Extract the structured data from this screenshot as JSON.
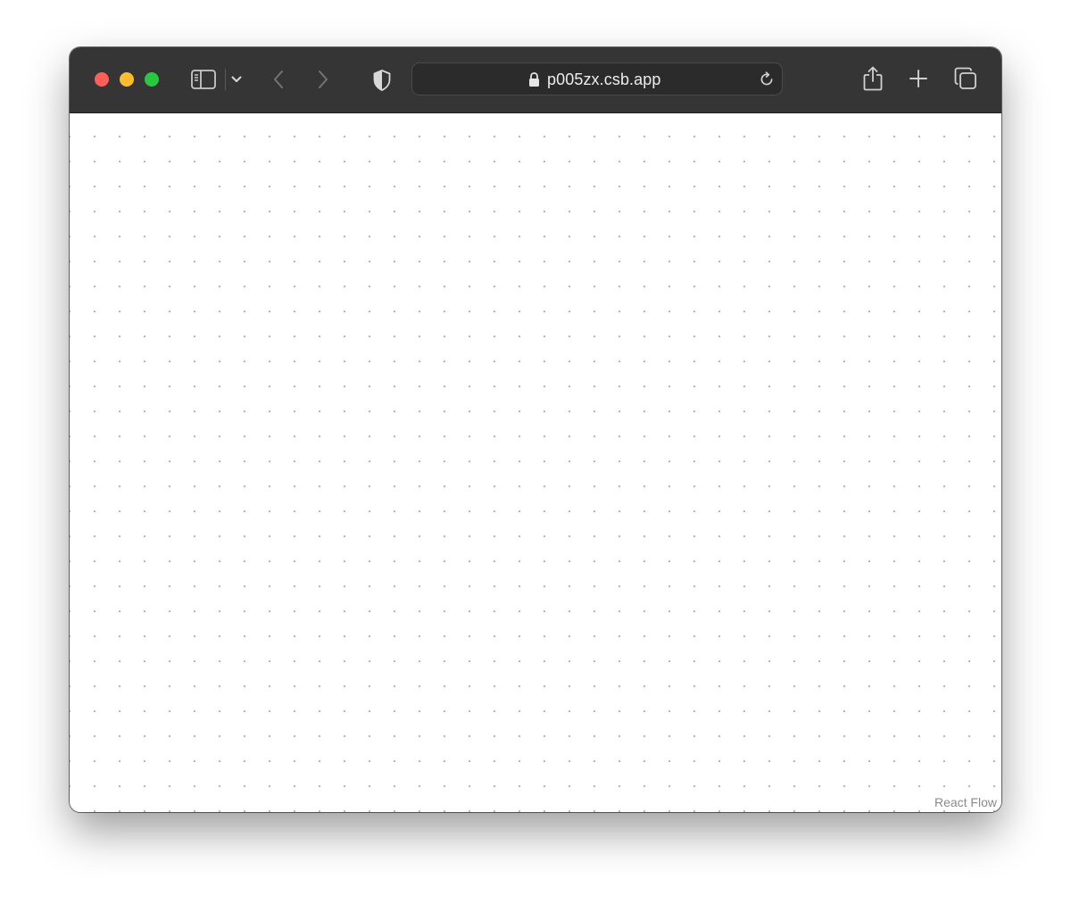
{
  "browser": {
    "address_url": "p005zx.csb.app",
    "toolbar_color": "#353535",
    "traffic_colors": {
      "close": "#fe5f57",
      "minimize": "#febc2e",
      "zoom": "#28c840"
    },
    "icons": [
      "sidebar-icon",
      "chevron-down-icon",
      "back-arrow-icon",
      "forward-arrow-icon",
      "privacy-shield-icon",
      "lock-icon",
      "reload-icon",
      "share-icon",
      "new-tab-plus-icon",
      "tab-overview-icon"
    ]
  },
  "canvas": {
    "attribution": "React Flow",
    "background": "dots"
  }
}
